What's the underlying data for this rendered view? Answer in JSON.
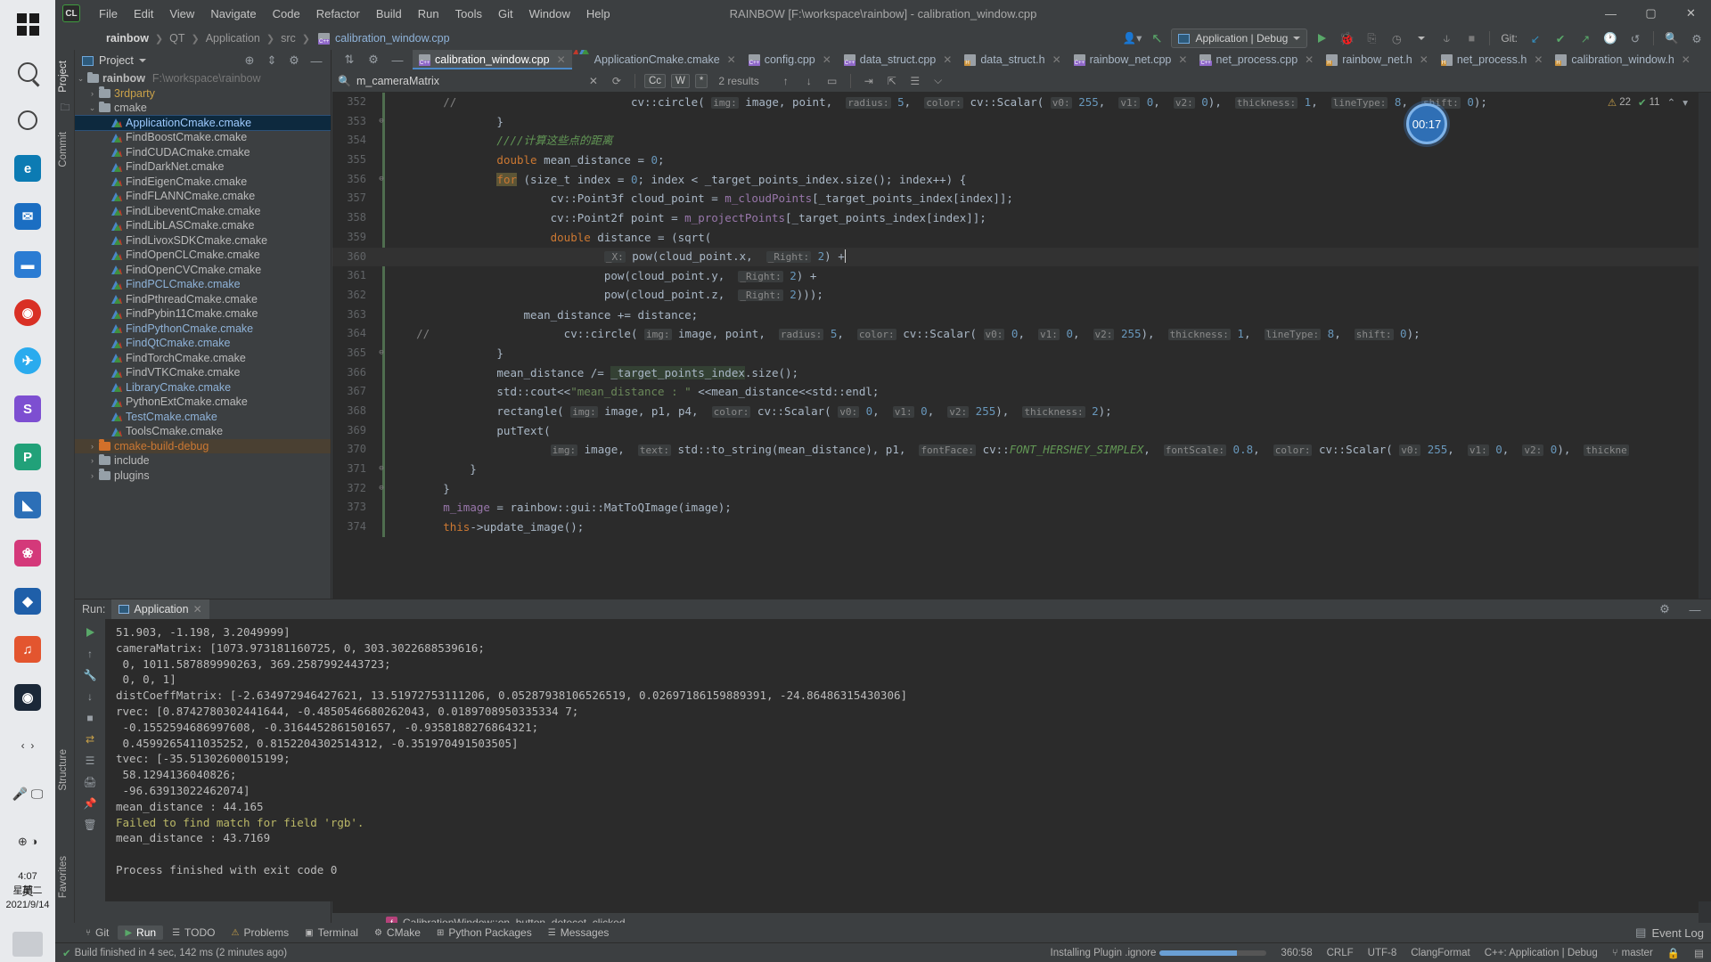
{
  "taskbar": {
    "icons": [
      "windows-start",
      "search",
      "cortana",
      "edge",
      "mail",
      "explorer",
      "chrome",
      "telegram",
      "app-store",
      "vscode",
      "photos",
      "blender",
      "music",
      "steam",
      "nav-arrows",
      "mic",
      "settings",
      "ime-cn"
    ],
    "clock_time": "4:07",
    "clock_day": "星期二",
    "clock_date": "2021/9/14"
  },
  "menubar": {
    "logo": "CL",
    "items": [
      "File",
      "Edit",
      "View",
      "Navigate",
      "Code",
      "Refactor",
      "Build",
      "Run",
      "Tools",
      "Git",
      "Window",
      "Help"
    ],
    "window_title": "RAINBOW [F:\\workspace\\rainbow] - calibration_window.cpp",
    "window_buttons": [
      "minimize",
      "maximize",
      "close"
    ]
  },
  "navbar": {
    "breadcrumbs": [
      "rainbow",
      "QT",
      "Application",
      "src",
      "calibration_window.cpp"
    ],
    "run_config": "Application | Debug",
    "git_label": "Git:",
    "right_icons": [
      "user-account",
      "update-project",
      "run",
      "debug",
      "attach-process",
      "profile",
      "coverage",
      "stop",
      "git-update",
      "git-commit",
      "git-push",
      "history",
      "revert",
      "search-everywhere",
      "settings"
    ]
  },
  "left_strip": {
    "tabs": [
      "Project",
      "Commit",
      "Structure",
      "Favorites"
    ]
  },
  "project": {
    "title": "Project",
    "root": {
      "name": "rainbow",
      "path": "F:\\workspace\\rainbow"
    },
    "items": [
      {
        "name": "3rdparty",
        "type": "folder",
        "depth": 1,
        "arrow": "›",
        "color": "yellow"
      },
      {
        "name": "cmake",
        "type": "folder",
        "depth": 1,
        "arrow": "⌄",
        "color": ""
      },
      {
        "name": "ApplicationCmake.cmake",
        "type": "cmake",
        "depth": 2,
        "selected": true,
        "color": "blue"
      },
      {
        "name": "FindBoostCmake.cmake",
        "type": "cmake",
        "depth": 2,
        "color": ""
      },
      {
        "name": "FindCUDACmake.cmake",
        "type": "cmake",
        "depth": 2,
        "color": ""
      },
      {
        "name": "FindDarkNet.cmake",
        "type": "cmake",
        "depth": 2,
        "color": ""
      },
      {
        "name": "FindEigenCmake.cmake",
        "type": "cmake",
        "depth": 2,
        "color": ""
      },
      {
        "name": "FindFLANNCmake.cmake",
        "type": "cmake",
        "depth": 2,
        "color": ""
      },
      {
        "name": "FindLibeventCmake.cmake",
        "type": "cmake",
        "depth": 2,
        "color": ""
      },
      {
        "name": "FindLibLASCmake.cmake",
        "type": "cmake",
        "depth": 2,
        "color": ""
      },
      {
        "name": "FindLivoxSDKCmake.cmake",
        "type": "cmake",
        "depth": 2,
        "color": ""
      },
      {
        "name": "FindOpenCLCmake.cmake",
        "type": "cmake",
        "depth": 2,
        "color": ""
      },
      {
        "name": "FindOpenCVCmake.cmake",
        "type": "cmake",
        "depth": 2,
        "color": ""
      },
      {
        "name": "FindPCLCmake.cmake",
        "type": "cmake",
        "depth": 2,
        "color": "blue"
      },
      {
        "name": "FindPthreadCmake.cmake",
        "type": "cmake",
        "depth": 2,
        "color": ""
      },
      {
        "name": "FindPybin11Cmake.cmake",
        "type": "cmake",
        "depth": 2,
        "color": ""
      },
      {
        "name": "FindPythonCmake.cmake",
        "type": "cmake",
        "depth": 2,
        "color": "blue"
      },
      {
        "name": "FindQtCmake.cmake",
        "type": "cmake",
        "depth": 2,
        "color": "blue"
      },
      {
        "name": "FindTorchCmake.cmake",
        "type": "cmake",
        "depth": 2,
        "color": ""
      },
      {
        "name": "FindVTKCmake.cmake",
        "type": "cmake",
        "depth": 2,
        "color": ""
      },
      {
        "name": "LibraryCmake.cmake",
        "type": "cmake",
        "depth": 2,
        "color": "blue"
      },
      {
        "name": "PythonExtCmake.cmake",
        "type": "cmake",
        "depth": 2,
        "color": ""
      },
      {
        "name": "TestCmake.cmake",
        "type": "cmake",
        "depth": 2,
        "color": "blue"
      },
      {
        "name": "ToolsCmake.cmake",
        "type": "cmake",
        "depth": 2,
        "color": ""
      },
      {
        "name": "cmake-build-debug",
        "type": "folder-orange",
        "depth": 1,
        "arrow": "›",
        "highlight": true,
        "color": "orange"
      },
      {
        "name": "include",
        "type": "folder",
        "depth": 1,
        "arrow": "›",
        "color": ""
      },
      {
        "name": "plugins",
        "type": "folder",
        "depth": 1,
        "arrow": "›",
        "color": ""
      }
    ]
  },
  "editor": {
    "tabs": [
      {
        "label": "calibration_window.cpp",
        "badge": "C++",
        "active": true
      },
      {
        "label": "ApplicationCmake.cmake",
        "badge": "cmake",
        "active": false
      },
      {
        "label": "config.cpp",
        "badge": "C++",
        "active": false
      },
      {
        "label": "data_struct.cpp",
        "badge": "C++",
        "active": false
      },
      {
        "label": "data_struct.h",
        "badge": "H",
        "active": false
      },
      {
        "label": "rainbow_net.cpp",
        "badge": "C++",
        "active": false
      },
      {
        "label": "net_process.cpp",
        "badge": "C++",
        "active": false
      },
      {
        "label": "rainbow_net.h",
        "badge": "H",
        "active": false
      },
      {
        "label": "net_process.h",
        "badge": "H",
        "active": false
      },
      {
        "label": "calibration_window.h",
        "badge": "H",
        "active": false
      }
    ],
    "find": {
      "query": "m_cameraMatrix",
      "results_label": "2 results",
      "match_case": "Cc",
      "words": "W",
      "regex": "*"
    },
    "warnings": {
      "warning_count": "22",
      "check_count": "11"
    },
    "breadcrumb": "CalibrationWindow::on_button_detecet_clicked",
    "timer_badge": "00:17",
    "lines": [
      {
        "n": 352,
        "fold": "",
        "html": "        <span class='cmt'>//</span>                          cv::circle( <span class='hint'>img:</span> image, point,  <span class='hint'>radius:</span> <span class='num'>5</span>,  <span class='hint'>color:</span> cv::Scalar( <span class='hint'>v0:</span> <span class='num'>255</span>,  <span class='hint'>v1:</span> <span class='num'>0</span>,  <span class='hint'>v2:</span> <span class='num'>0</span>),  <span class='hint'>thickness:</span> <span class='num'>1</span>,  <span class='hint'>lineType:</span> <span class='num'>8</span>,  <span class='hint'>shift:</span> <span class='num'>0</span>);"
      },
      {
        "n": 353,
        "fold": "⊖",
        "html": "                }"
      },
      {
        "n": 354,
        "fold": "",
        "html": "                <span class='cmtg'>////计算这些点的距离</span>"
      },
      {
        "n": 355,
        "fold": "",
        "html": "                <span class='kw'>double</span> mean_distance = <span class='num'>0</span>;"
      },
      {
        "n": 356,
        "fold": "⊖",
        "html": "                <span class='kw-hl'>for</span> (size_t index = <span class='num'>0</span>; index &lt; _target_points_index.size(); index++) {"
      },
      {
        "n": 357,
        "fold": "",
        "html": "                        cv::Point3f cloud_point = <span class='fld'>m_cloudPoints</span>[_target_points_index[index]];"
      },
      {
        "n": 358,
        "fold": "",
        "html": "                        cv::Point2f point = <span class='fld'>m_projectPoints</span>[_target_points_index[index]];"
      },
      {
        "n": 359,
        "fold": "",
        "html": "                        <span class='kw'>double</span> distance = (sqrt("
      },
      {
        "n": 360,
        "fold": "",
        "html": "                                <span class='hint'>_X:</span> pow(cloud_point.x,  <span class='hint'>_Right:</span> <span class='num'>2</span>) +<span class='caret-bar'></span>"
      },
      {
        "n": 361,
        "fold": "",
        "html": "                                pow(cloud_point.y,  <span class='hint'>_Right:</span> <span class='num'>2</span>) +"
      },
      {
        "n": 362,
        "fold": "",
        "html": "                                pow(cloud_point.z,  <span class='hint'>_Right:</span> <span class='num'>2</span>)));"
      },
      {
        "n": 363,
        "fold": "",
        "html": "                    mean_distance += distance;"
      },
      {
        "n": 364,
        "fold": "",
        "html": "    <span class='cmt'>//</span>                    cv::circle( <span class='hint'>img:</span> image, point,  <span class='hint'>radius:</span> <span class='num'>5</span>,  <span class='hint'>color:</span> cv::Scalar( <span class='hint'>v0:</span> <span class='num'>0</span>,  <span class='hint'>v1:</span> <span class='num'>0</span>,  <span class='hint'>v2:</span> <span class='num'>255</span>),  <span class='hint'>thickness:</span> <span class='num'>1</span>,  <span class='hint'>lineType:</span> <span class='num'>8</span>,  <span class='hint'>shift:</span> <span class='num'>0</span>);"
      },
      {
        "n": 365,
        "fold": "⊖",
        "html": "                }"
      },
      {
        "n": 366,
        "fold": "",
        "html": "                mean_distance /= <span class='hl-ident'>_target_points_index</span>.size();"
      },
      {
        "n": 367,
        "fold": "",
        "html": "                std::cout&lt;&lt;<span class='str'>\"mean_distance : \"</span> &lt;&lt;mean_distance&lt;&lt;std::endl;"
      },
      {
        "n": 368,
        "fold": "",
        "html": "                rectangle( <span class='hint'>img:</span> image, p1, p4,  <span class='hint'>color:</span> cv::Scalar( <span class='hint'>v0:</span> <span class='num'>0</span>,  <span class='hint'>v1:</span> <span class='num'>0</span>,  <span class='hint'>v2:</span> <span class='num'>255</span>),  <span class='hint'>thickness:</span> <span class='num'>2</span>);"
      },
      {
        "n": 369,
        "fold": "",
        "html": "                putText("
      },
      {
        "n": 370,
        "fold": "",
        "html": "                        <span class='hint'>img:</span> image,  <span class='hint'>text:</span> std::to_string(mean_distance), p1,  <span class='hint'>fontFace:</span> cv::<span class='cmtg'>FONT_HERSHEY_SIMPLEX</span>,  <span class='hint'>fontScale:</span> <span class='num'>0.8</span>,  <span class='hint'>color:</span> cv::Scalar( <span class='hint'>v0:</span> <span class='num'>255</span>,  <span class='hint'>v1:</span> <span class='num'>0</span>,  <span class='hint'>v2:</span> <span class='num'>0</span>),  <span class='hint'>thickne</span>"
      },
      {
        "n": 371,
        "fold": "⊖",
        "html": "            }"
      },
      {
        "n": 372,
        "fold": "⊖",
        "html": "        }"
      },
      {
        "n": 373,
        "fold": "",
        "html": "        <span class='fld'>m_image</span> = rainbow::gui::MatToQImage(image);"
      },
      {
        "n": 374,
        "fold": "",
        "html": "        <span class='kw'>this</span>-&gt;update_image();"
      }
    ]
  },
  "run_panel": {
    "label": "Run:",
    "tab": "Application",
    "side_icons": [
      "rerun",
      "scroll-up",
      "wrench",
      "scroll-down",
      "stop",
      "wrap",
      "print",
      "pin",
      "trash"
    ],
    "console": [
      {
        "text": "51.903, -1.198, 3.2049999]",
        "type": "normal"
      },
      {
        "text": "cameraMatrix: [1073.973181160725, 0, 303.3022688539616;",
        "type": "normal"
      },
      {
        "text": " 0, 1011.587889990263, 369.2587992443723;",
        "type": "normal"
      },
      {
        "text": " 0, 0, 1]",
        "type": "normal"
      },
      {
        "text": "distCoeffMatrix: [-2.634972946427621, 13.51972753111206, 0.05287938106526519, 0.02697186159889391, -24.86486315430306]",
        "type": "normal"
      },
      {
        "text": "rvec: [0.8742780302441644, -0.4850546680262043, 0.0189708950335334 7;",
        "type": "normal"
      },
      {
        "text": " -0.1552594686997608, -0.3164452861501657, -0.9358188276864321;",
        "type": "normal"
      },
      {
        "text": " 0.4599265411035252, 0.8152204302514312, -0.351970491503505]",
        "type": "normal"
      },
      {
        "text": "tvec: [-35.51302600015199;",
        "type": "normal"
      },
      {
        "text": " 58.1294136040826;",
        "type": "normal"
      },
      {
        "text": " -96.63913022462074]",
        "type": "normal"
      },
      {
        "text": "mean_distance : 44.165",
        "type": "normal"
      },
      {
        "text": "Failed to find match for field 'rgb'.",
        "type": "warn"
      },
      {
        "text": "mean_distance : 43.7169",
        "type": "normal"
      },
      {
        "text": "",
        "type": "normal"
      },
      {
        "text": "Process finished with exit code 0",
        "type": "normal"
      }
    ]
  },
  "bottom_bar": {
    "windows": [
      {
        "label": "Git",
        "icon": "git-icon",
        "active": false
      },
      {
        "label": "Run",
        "icon": "run-icon",
        "active": true
      },
      {
        "label": "TODO",
        "icon": "todo-icon",
        "active": false
      },
      {
        "label": "Problems",
        "icon": "problems-icon",
        "active": false
      },
      {
        "label": "Terminal",
        "icon": "terminal-icon",
        "active": false
      },
      {
        "label": "CMake",
        "icon": "cmake-icon",
        "active": false
      },
      {
        "label": "Python Packages",
        "icon": "python-icon",
        "active": false
      },
      {
        "label": "Messages",
        "icon": "messages-icon",
        "active": false
      }
    ],
    "event_log": "Event Log"
  },
  "status_bar": {
    "build_message": "Build finished in 4 sec, 142 ms (2 minutes ago)",
    "plugin_message": "Installing Plugin .ignore",
    "progress_percent": 72,
    "caret_position": "360:58",
    "line_separator": "CRLF",
    "encoding": "UTF-8",
    "formatter": "ClangFormat",
    "config": "C++: Application | Debug",
    "branch": "master",
    "lock_icon": "lock-icon",
    "colors": {
      "accent": "#4a88c7",
      "green": "#59a869",
      "warn": "#bbb867",
      "link": "#8fb3d9"
    }
  }
}
